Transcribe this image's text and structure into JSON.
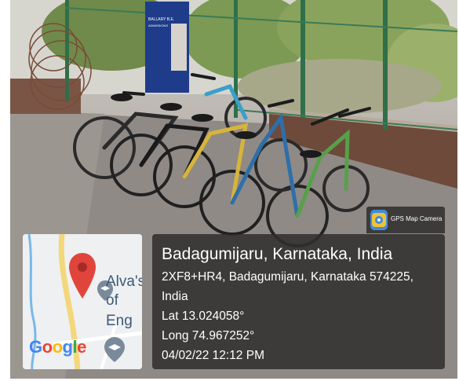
{
  "badge": {
    "label": "GPS Map Camera",
    "icon": "camera-map-icon"
  },
  "photo_sign": {
    "line1": "BALLARY B.E.",
    "line2": "ADMISSIONS"
  },
  "map": {
    "place_label_1": "Alva's",
    "place_label_2": "of Eng",
    "logo": "Google",
    "pin_icon": "location-pin-icon",
    "school_icon": "graduation-cap-icon",
    "colors": {
      "pin": "#e0453c",
      "road": "#f3d77a",
      "water": "#79b8e8"
    }
  },
  "info": {
    "title": "Badagumijaru, Karnataka, India",
    "address_line1": "2XF8+HR4, Badagumijaru, Karnataka 574225,",
    "address_line2": "India",
    "lat": "Lat 13.024058°",
    "long": "Long 74.967252°",
    "datetime": "04/02/22 12:12 PM"
  }
}
